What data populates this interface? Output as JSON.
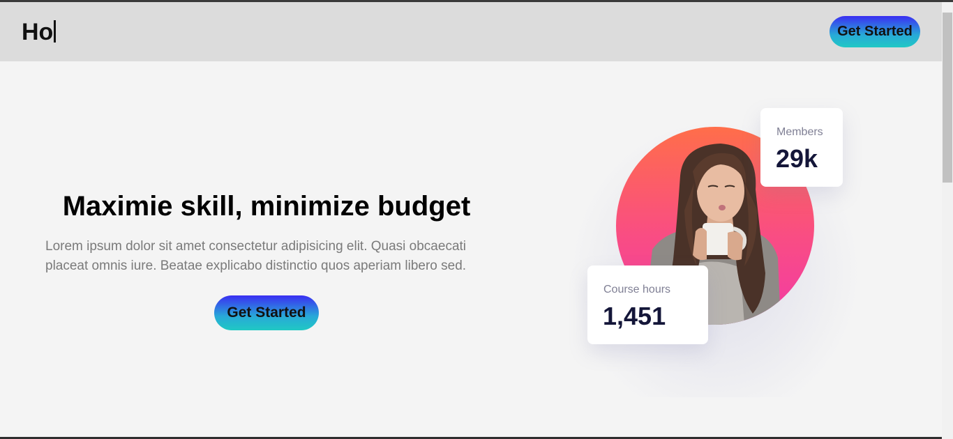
{
  "header": {
    "logo_text": "Ho",
    "cta_label": "Get Started"
  },
  "hero": {
    "title": "Maximie skill, minimize budget",
    "description": "Lorem ipsum dolor sit amet consectetur adipisicing elit. Quasi obcaecati placeat omnis iure. Beatae explicabo distinctio quos aperiam libero sed.",
    "cta_label": "Get Started"
  },
  "stats": {
    "members": {
      "label": "Members",
      "value": "29k"
    },
    "course_hours": {
      "label": "Course hours",
      "value": "1,451"
    }
  },
  "colors": {
    "button_gradient_top": "#3a2ef2",
    "button_gradient_bottom": "#20c8c4",
    "circle_gradient_top": "#ff6e4a",
    "circle_gradient_bottom": "#f23ba6",
    "stat_value": "#141639",
    "header_bg": "#dcdcdc",
    "page_bg": "#f4f4f4"
  },
  "icons": {
    "hero_image": "woman-drinking-coffee-photo"
  }
}
